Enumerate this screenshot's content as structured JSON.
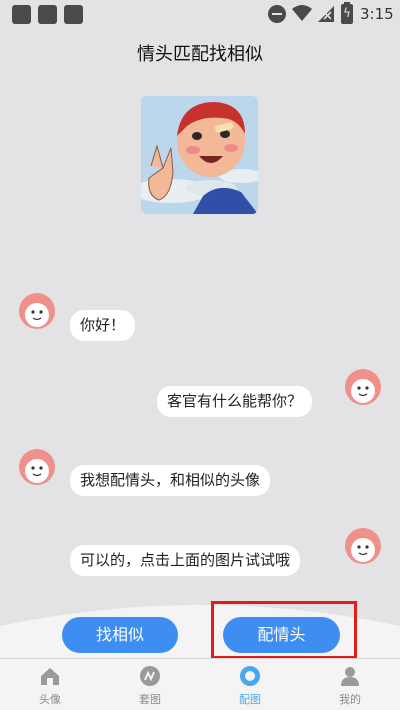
{
  "status_bar": {
    "time": "3:15",
    "icons": [
      "app-square-icon",
      "app-square-icon",
      "app-square-icon",
      "do-not-disturb-icon",
      "wifi-icon",
      "signal-off-icon",
      "battery-charging-icon"
    ]
  },
  "page": {
    "title": "情头匹配找相似"
  },
  "chat": {
    "messages": [
      {
        "side": "left",
        "text": "你好！"
      },
      {
        "side": "right",
        "text": "客官有什么能帮你？"
      },
      {
        "side": "left",
        "text": "我想配情头，和相似的头像"
      },
      {
        "side": "right",
        "text": "可以的，点击上面的图片试试哦"
      }
    ]
  },
  "actions": {
    "find_similar": "找相似",
    "match_couple": "配情头"
  },
  "tabs": [
    {
      "label": "头像",
      "icon": "home-icon",
      "active": false
    },
    {
      "label": "套图",
      "icon": "album-icon",
      "active": false
    },
    {
      "label": "配图",
      "icon": "match-icon",
      "active": true
    },
    {
      "label": "我的",
      "icon": "profile-icon",
      "active": false
    }
  ],
  "colors": {
    "accent": "#3d8ef0",
    "highlight": "#e21b1b",
    "active_tab": "#49a7f0",
    "background": "#e3e3e6",
    "bot_avatar": "#f0908a"
  }
}
